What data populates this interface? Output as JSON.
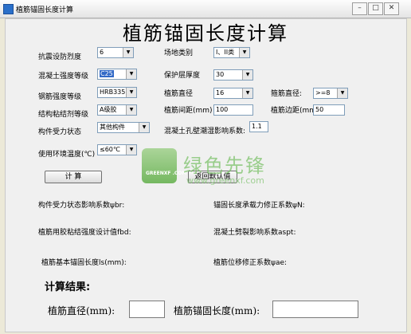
{
  "window": {
    "title": "植筋锚固长度计算",
    "min_glyph": "–",
    "max_glyph": "□",
    "close_glyph": "✕"
  },
  "main_title": "植筋锚固长度计算",
  "form": {
    "seismic_grade": {
      "label": "抗震设防烈度",
      "value": "6"
    },
    "site_class": {
      "label": "场地类别",
      "value": "I、II类"
    },
    "concrete_grade": {
      "label": "混凝土强度等级",
      "value": "C25"
    },
    "cover_thickness": {
      "label": "保护层厚度",
      "value": "30"
    },
    "steel_grade": {
      "label": "钢筋强度等级",
      "value": "HRB335"
    },
    "bar_diameter": {
      "label": "植筋直径",
      "value": "16"
    },
    "stirrup_diameter": {
      "label": "箍筋直径:",
      "value": ">=8"
    },
    "adhesive_grade": {
      "label": "结构粘结剂等级",
      "value": "A级胶"
    },
    "bar_spacing": {
      "label": "植筋间距(mm)",
      "value": "100"
    },
    "edge_distance": {
      "label": "植筋边距(mm)",
      "value": "50"
    },
    "stress_state": {
      "label": "构件受力状态",
      "value": "其他构件"
    },
    "crack_factor": {
      "label": "混凝土孔壁潮湿影响系数:",
      "value": "1.1"
    },
    "env_temp": {
      "label": "使用环境温度(℃)",
      "value": "≤60℃"
    }
  },
  "buttons": {
    "calc": "计  算",
    "reset": "返回默认值"
  },
  "factors": {
    "psi_br": "构件受力状态影响系数ψbr:",
    "psi_n": "锚固长度承载力修正系数ψN:",
    "fbd": "植筋用胶粘结强度设计值fbd:",
    "a_spt": "混凝土劈裂影响系数aspt:",
    "ls": "植筋基本锚固长度ls(mm):",
    "psi_ae": "植筋位移修正系数ψae:"
  },
  "results": {
    "title": "计算结果:",
    "diameter_label": "植筋直径(mm):",
    "diameter_value": "",
    "anchor_label": "植筋锚固长度(mm):",
    "anchor_value": ""
  },
  "watermark": {
    "cn": "绿色先锋",
    "url": "www.greenxf.com",
    "logo": "GREENXF .COM"
  }
}
